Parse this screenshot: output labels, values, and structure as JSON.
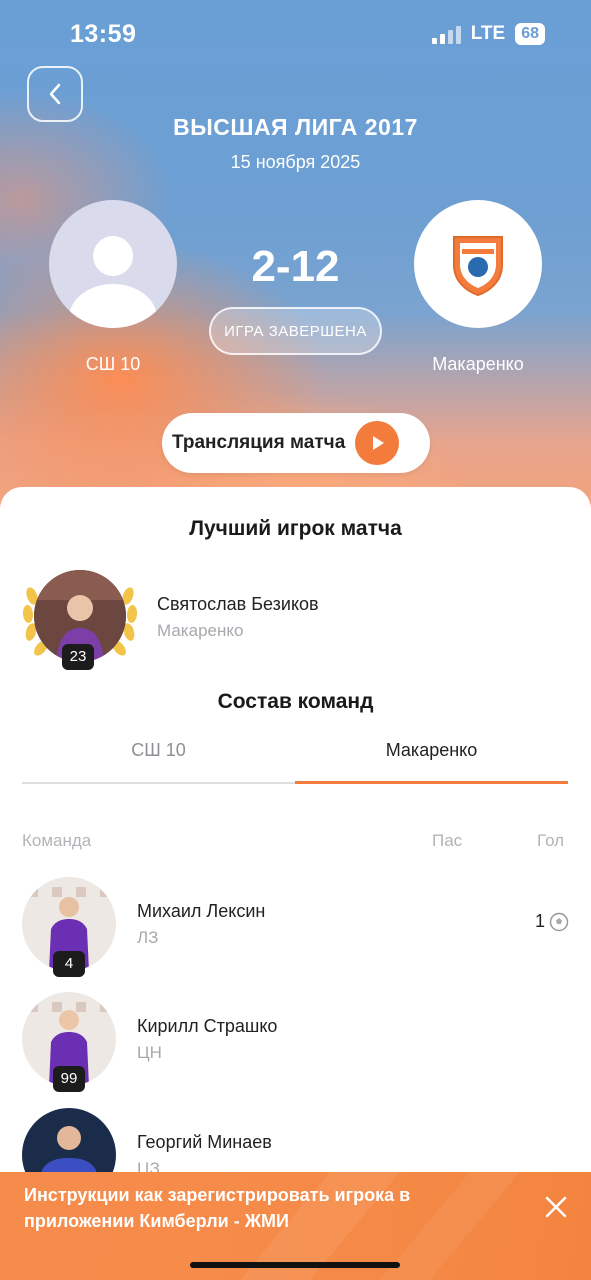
{
  "status_bar": {
    "time": "13:59",
    "network": "LTE",
    "battery": "68"
  },
  "match": {
    "league": "ВЫСШАЯ ЛИГА  2017",
    "date": "15 ноября 2025",
    "score": "2-12",
    "status": "ИГРА ЗАВЕРШЕНА",
    "home_team": "СШ 10",
    "away_team": "Макаренко",
    "stream_label": "Трансляция матча"
  },
  "best_player": {
    "section_title": "Лучший игрок матча",
    "name": "Святослав Безиков",
    "team": "Макаренко",
    "number": "23"
  },
  "lineups": {
    "section_title": "Состав команд",
    "tabs": [
      {
        "label": "СШ 10",
        "active": false
      },
      {
        "label": "Макаренко",
        "active": true
      }
    ],
    "columns": {
      "team": "Команда",
      "assists": "Пас",
      "goals": "Гол"
    },
    "players": [
      {
        "name": "Михаил Лексин",
        "position": "ЛЗ",
        "number": "4",
        "goals": "1"
      },
      {
        "name": "Кирилл Страшко",
        "position": "ЦН",
        "number": "99",
        "goals": ""
      },
      {
        "name": "Георгий Минаев",
        "position": "ЦЗ",
        "number": "",
        "goals": ""
      }
    ]
  },
  "banner": {
    "text": "Инструкции как зарегистрировать игрока в приложении Кимберли - ЖМИ"
  },
  "colors": {
    "accent": "#f37b3c",
    "hero_blue": "#6a9fd6",
    "muted": "#a8a8ae"
  }
}
